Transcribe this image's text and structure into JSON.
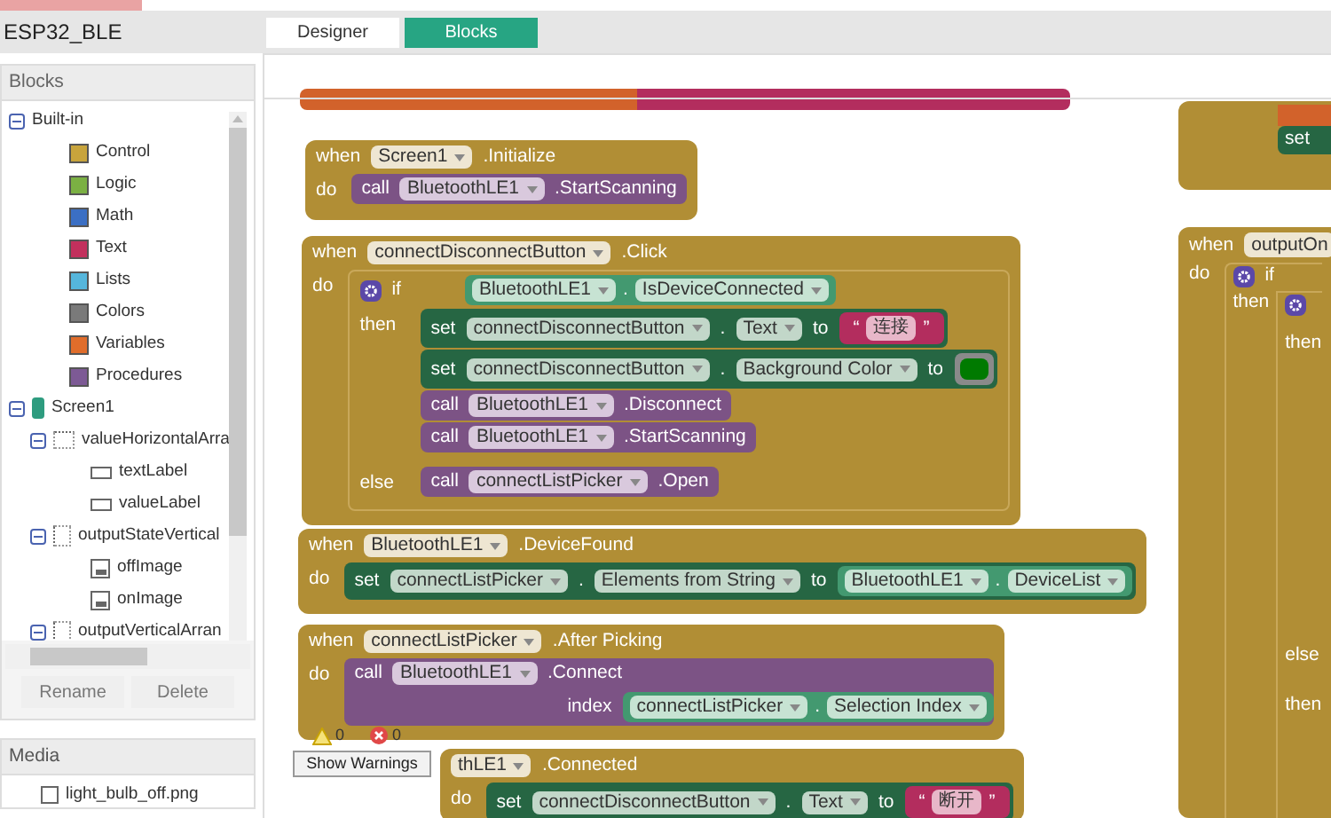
{
  "app_title": "ESP32_BLE",
  "tabs": [
    {
      "label": "Designer",
      "selected": false
    },
    {
      "label": "Blocks",
      "selected": true
    }
  ],
  "blocks_panel": {
    "title": "Blocks",
    "tree": [
      {
        "label": "Built-in",
        "kind": "group",
        "expanded": true,
        "children": [
          {
            "label": "Control",
            "kind": "drawer",
            "color": "#c8a43c"
          },
          {
            "label": "Logic",
            "kind": "drawer",
            "color": "#7bb043"
          },
          {
            "label": "Math",
            "kind": "drawer",
            "color": "#3b6fc4"
          },
          {
            "label": "Text",
            "kind": "drawer",
            "color": "#c2305d"
          },
          {
            "label": "Lists",
            "kind": "drawer",
            "color": "#55b6dc"
          },
          {
            "label": "Colors",
            "kind": "drawer",
            "color": "#7a7a7a"
          },
          {
            "label": "Variables",
            "kind": "drawer",
            "color": "#e06d2b"
          },
          {
            "label": "Procedures",
            "kind": "drawer",
            "color": "#7d5a95"
          }
        ]
      },
      {
        "label": "Screen1",
        "kind": "screen",
        "expanded": true,
        "children": [
          {
            "label": "valueHorizontalArra",
            "kind": "horizontal",
            "expanded": true,
            "children": [
              {
                "label": "textLabel",
                "kind": "label"
              },
              {
                "label": "valueLabel",
                "kind": "label"
              }
            ]
          },
          {
            "label": "outputStateVertical",
            "kind": "vertical",
            "expanded": true,
            "children": [
              {
                "label": "offImage",
                "kind": "image"
              },
              {
                "label": "onImage",
                "kind": "image"
              }
            ]
          },
          {
            "label": "outputVerticalArran",
            "kind": "vertical",
            "expanded": true
          }
        ]
      }
    ],
    "buttons": [
      "Rename",
      "Delete"
    ]
  },
  "media_panel": {
    "title": "Media",
    "items": [
      "light_bulb_off.png"
    ]
  },
  "warnings": {
    "warning_count": "0",
    "error_count": "0",
    "button": "Show Warnings"
  },
  "workspace": {
    "events": [
      {
        "keyword": "when",
        "component": "Screen1",
        "event": ".Initialize",
        "do": "do",
        "body": [
          {
            "kind": "call",
            "keyword": "call",
            "component": "BluetoothLE1",
            "method": ".StartScanning"
          }
        ]
      },
      {
        "keyword": "when",
        "component": "connectDisconnectButton",
        "event": ".Click",
        "do": "do",
        "body": [
          {
            "kind": "if",
            "keyword": "if",
            "condition": {
              "kind": "getter",
              "component": "BluetoothLE1",
              "dot": ".",
              "property": "IsDeviceConnected"
            },
            "then_label": "then",
            "then": [
              {
                "kind": "set",
                "keyword": "set",
                "component": "connectDisconnectButton",
                "dot": ".",
                "property": "Text",
                "to": "to",
                "value": {
                  "kind": "text",
                  "open": "“",
                  "text": "连接",
                  "close": "”"
                }
              },
              {
                "kind": "set",
                "keyword": "set",
                "component": "connectDisconnectButton",
                "dot": ".",
                "property": "Background Color",
                "to": "to",
                "value": {
                  "kind": "color",
                  "color": "#007a00"
                }
              },
              {
                "kind": "call",
                "keyword": "call",
                "component": "BluetoothLE1",
                "method": ".Disconnect"
              },
              {
                "kind": "call",
                "keyword": "call",
                "component": "BluetoothLE1",
                "method": ".StartScanning"
              }
            ],
            "else_label": "else",
            "else": [
              {
                "kind": "call",
                "keyword": "call",
                "component": "connectListPicker",
                "method": ".Open"
              }
            ]
          }
        ]
      },
      {
        "keyword": "when",
        "component": "BluetoothLE1",
        "event": ".DeviceFound",
        "do": "do",
        "body": [
          {
            "kind": "set",
            "keyword": "set",
            "component": "connectListPicker",
            "dot": ".",
            "property": "Elements from String",
            "to": "to",
            "value": {
              "kind": "getter",
              "component": "BluetoothLE1",
              "dot": ".",
              "property": "DeviceList"
            }
          }
        ]
      },
      {
        "keyword": "when",
        "component": "connectListPicker",
        "event": ".After Picking",
        "do": "do",
        "body": [
          {
            "kind": "call",
            "keyword": "call",
            "component": "BluetoothLE1",
            "method": ".Connect",
            "args": [
              {
                "name": "index",
                "value": {
                  "kind": "getter",
                  "component": "connectListPicker",
                  "dot": ".",
                  "property": "Selection Index"
                }
              }
            ]
          }
        ]
      },
      {
        "component": "thLE1",
        "event": ".Connected",
        "do": "do",
        "body": [
          {
            "kind": "set",
            "keyword": "set",
            "component": "connectDisconnectButton",
            "dot": ".",
            "property": "Text",
            "to": "to",
            "value": {
              "kind": "text",
              "open": "“",
              "text": "断开",
              "close": "”"
            }
          }
        ]
      }
    ],
    "side_blocks": [
      {
        "kind": "set_stub",
        "keyword": "set"
      },
      {
        "kind": "event_stub",
        "keyword": "when",
        "component": "outputOn",
        "do": "do",
        "if_label": "if",
        "then_label": "then",
        "inner_then": "then",
        "else_label": "else",
        "else_then": "then"
      }
    ]
  }
}
